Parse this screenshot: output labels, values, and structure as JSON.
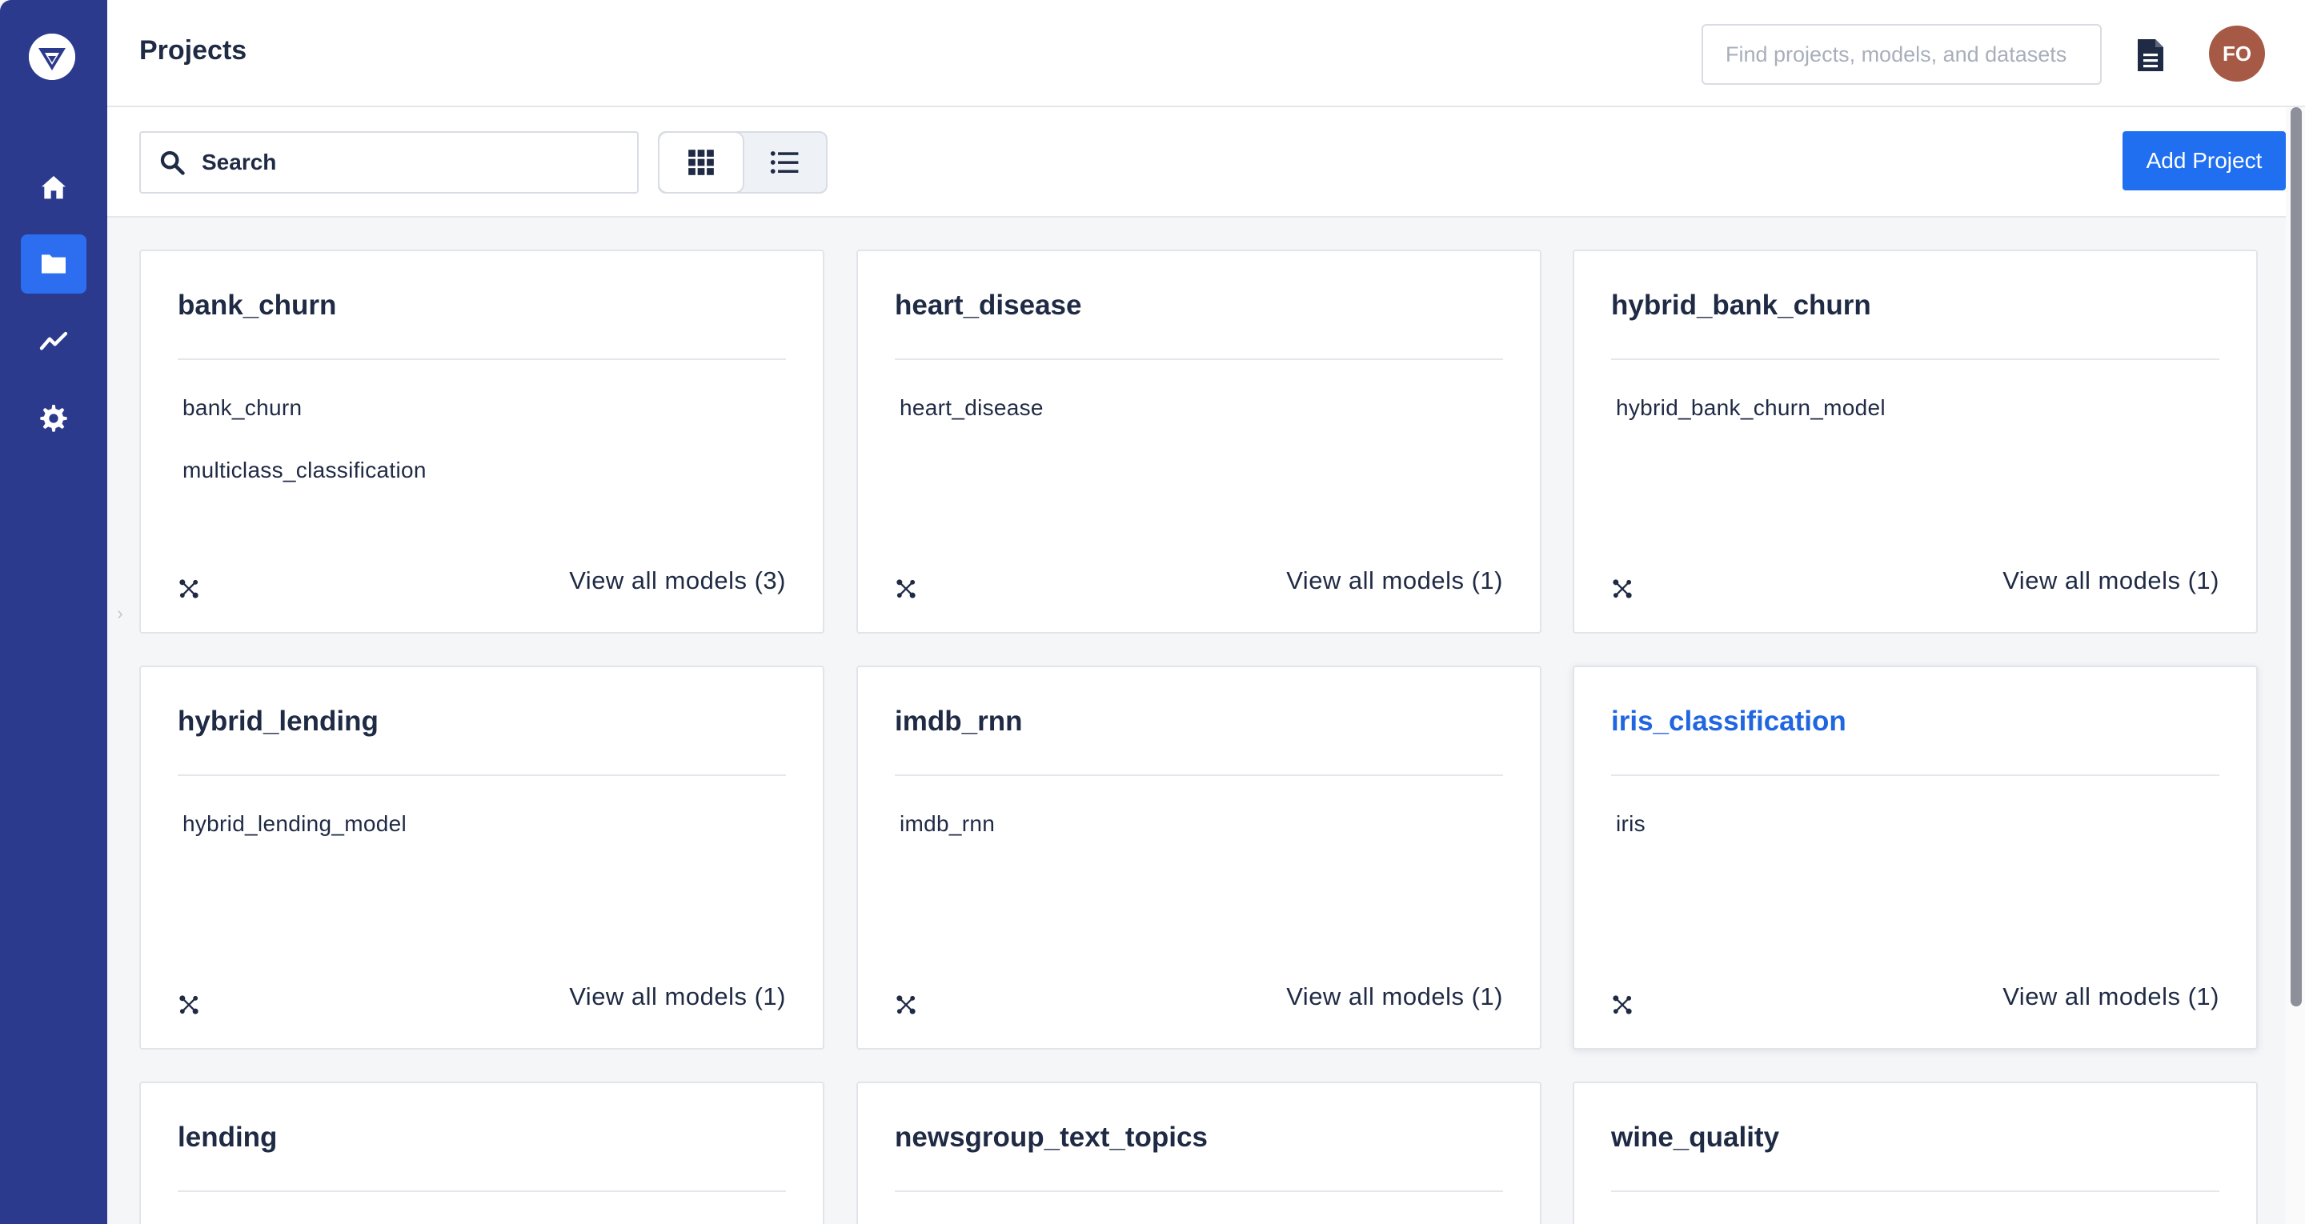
{
  "header": {
    "title": "Projects",
    "search_placeholder": "Find projects, models, and datasets",
    "avatar_initials": "FO"
  },
  "toolbar": {
    "search_placeholder": "Search",
    "add_project_label": "Add Project",
    "view_mode": "grid"
  },
  "sidebar": {
    "items": [
      {
        "name": "home",
        "icon": "home-icon",
        "active": false
      },
      {
        "name": "projects",
        "icon": "folder-icon",
        "active": true
      },
      {
        "name": "analytics",
        "icon": "chart-line-icon",
        "active": false
      },
      {
        "name": "settings",
        "icon": "gear-icon",
        "active": false
      }
    ]
  },
  "colors": {
    "sidebar": "#2b3a8c",
    "accent": "#1f6ff0",
    "link": "#2066e0",
    "avatar": "#a65a45"
  },
  "projects": [
    {
      "title": "bank_churn",
      "models": [
        "bank_churn",
        "multiclass_classification"
      ],
      "view_all": "View all models (3)"
    },
    {
      "title": "heart_disease",
      "models": [
        "heart_disease"
      ],
      "view_all": "View all models (1)"
    },
    {
      "title": "hybrid_bank_churn",
      "models": [
        "hybrid_bank_churn_model"
      ],
      "view_all": "View all models (1)"
    },
    {
      "title": "hybrid_lending",
      "models": [
        "hybrid_lending_model"
      ],
      "view_all": "View all models (1)"
    },
    {
      "title": "imdb_rnn",
      "models": [
        "imdb_rnn"
      ],
      "view_all": "View all models (1)"
    },
    {
      "title": "iris_classification",
      "models": [
        "iris"
      ],
      "view_all": "View all models (1)"
    },
    {
      "title": "lending",
      "models": [],
      "view_all": ""
    },
    {
      "title": "newsgroup_text_topics",
      "models": [],
      "view_all": ""
    },
    {
      "title": "wine_quality",
      "models": [],
      "view_all": ""
    }
  ]
}
